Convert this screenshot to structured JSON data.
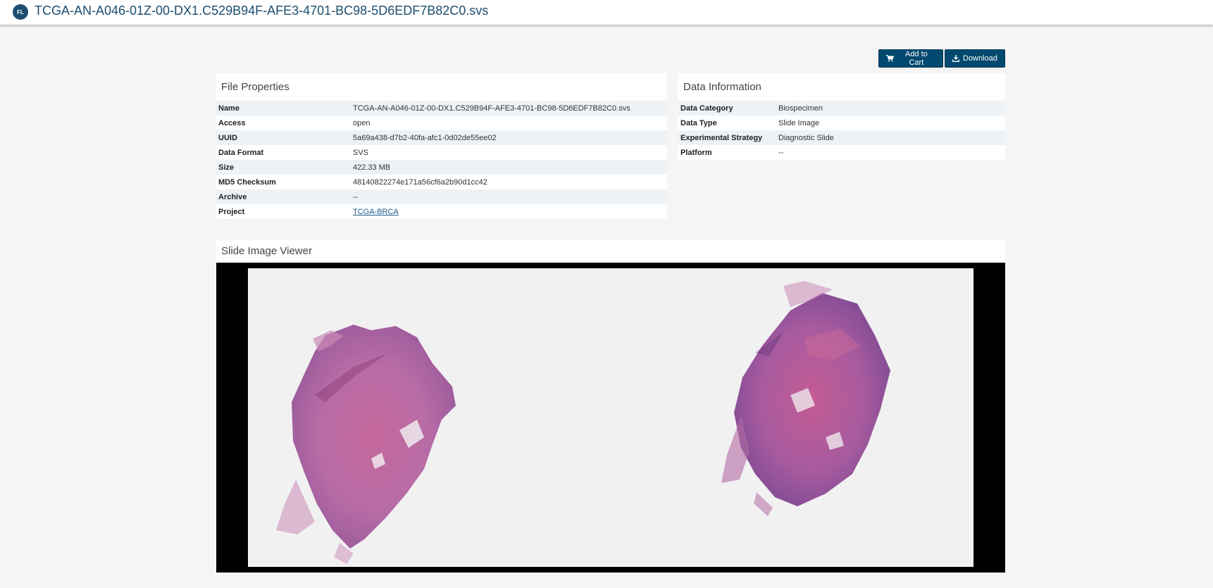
{
  "header": {
    "badge": "FL",
    "title": "TCGA-AN-A046-01Z-00-DX1.C529B94F-AFE3-4701-BC98-5D6EDF7B82C0.svs"
  },
  "actions": {
    "add_to_cart": "Add to Cart",
    "download": "Download"
  },
  "file_properties": {
    "title": "File Properties",
    "rows": [
      {
        "label": "Name",
        "value": "TCGA-AN-A046-01Z-00-DX1.C529B94F-AFE3-4701-BC98-5D6EDF7B82C0.svs"
      },
      {
        "label": "Access",
        "value": "open"
      },
      {
        "label": "UUID",
        "value": "5a69a438-d7b2-40fa-afc1-0d02de55ee02"
      },
      {
        "label": "Data Format",
        "value": "SVS"
      },
      {
        "label": "Size",
        "value": "422.33 MB"
      },
      {
        "label": "MD5 Checksum",
        "value": "48140822274e171a56cf6a2b90d1cc42"
      },
      {
        "label": "Archive",
        "value": "--"
      },
      {
        "label": "Project",
        "value": "TCGA-BRCA"
      }
    ]
  },
  "data_information": {
    "title": "Data Information",
    "rows": [
      {
        "label": "Data Category",
        "value": "Biospecimen"
      },
      {
        "label": "Data Type",
        "value": "Slide Image"
      },
      {
        "label": "Experimental Strategy",
        "value": "Diagnostic Slide"
      },
      {
        "label": "Platform",
        "value": "--"
      }
    ]
  },
  "viewer": {
    "title": "Slide Image Viewer"
  },
  "colors": {
    "brand": "#1c4d6f",
    "button": "#01496f",
    "row_stripe": "#edf2f6",
    "tissue": "#b25a9a"
  },
  "icons": {
    "badge": "file-badge-icon",
    "cart": "cart-icon",
    "download": "download-icon"
  }
}
